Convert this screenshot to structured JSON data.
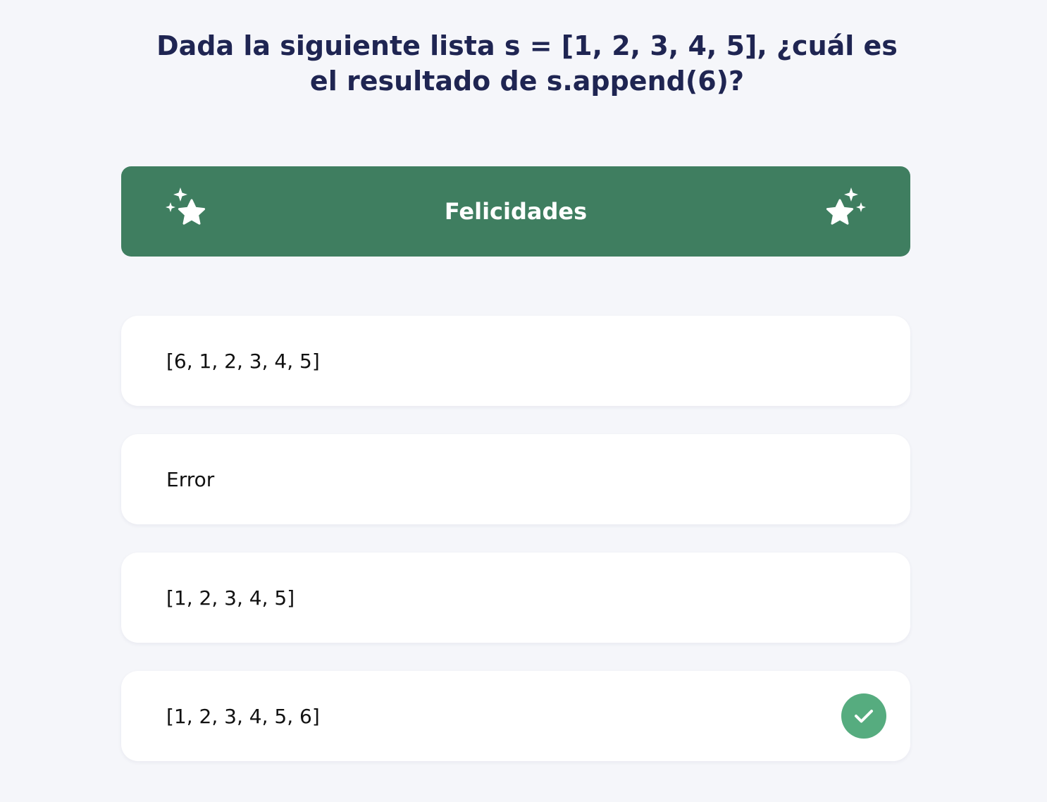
{
  "question": {
    "text": "Dada la siguiente lista s = [1, 2, 3, 4, 5], ¿cuál es el resultado de s.append(6)?"
  },
  "banner": {
    "title": "Felicidades",
    "icon": "sparkle-star-icon",
    "color": "#3f7e60"
  },
  "options": [
    {
      "label": "[6, 1, 2, 3, 4, 5]",
      "correct": false
    },
    {
      "label": "Error",
      "correct": false
    },
    {
      "label": "[1, 2, 3, 4, 5]",
      "correct": false
    },
    {
      "label": "[1, 2, 3, 4, 5, 6]",
      "correct": true
    }
  ],
  "colors": {
    "background": "#f5f6fa",
    "question_text": "#1f2552",
    "correct_badge": "#56ac7f"
  }
}
